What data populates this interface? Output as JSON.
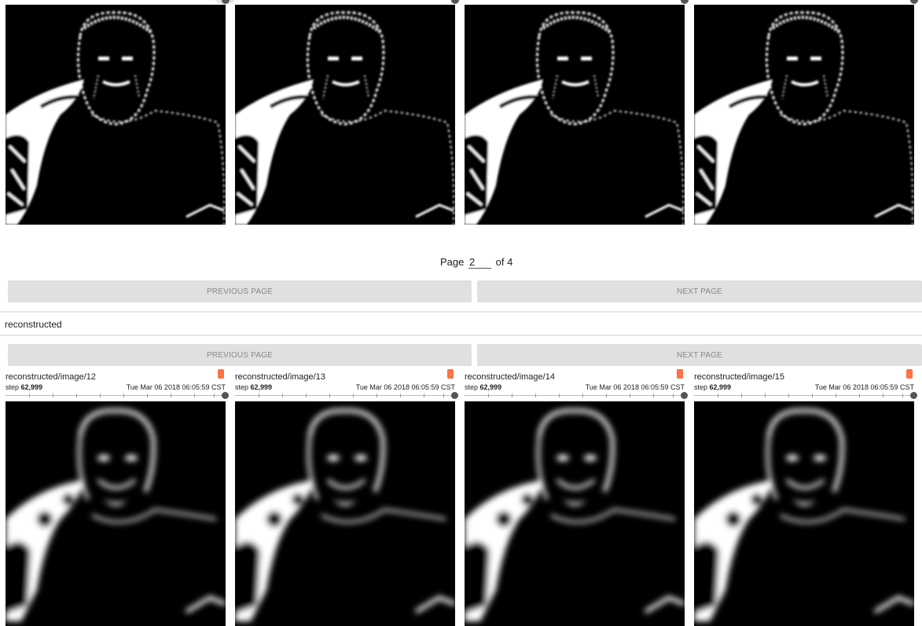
{
  "pagination": {
    "page_prefix": "Page",
    "page_value": "2",
    "page_suffix": "of 4",
    "previous_label": "PREVIOUS PAGE",
    "next_label": "NEXT PAGE"
  },
  "section": {
    "title": "reconstructed"
  },
  "cards": [
    {
      "title": "reconstructed/image/12",
      "step_label": "step",
      "step_value": "62,999",
      "time": "Tue Mar 06 2018 06:05:59 CST"
    },
    {
      "title": "reconstructed/image/13",
      "step_label": "step",
      "step_value": "62,999",
      "time": "Tue Mar 06 2018 06:05:59 CST"
    },
    {
      "title": "reconstructed/image/14",
      "step_label": "step",
      "step_value": "62,999",
      "time": "Tue Mar 06 2018 06:05:59 CST"
    },
    {
      "title": "reconstructed/image/15",
      "step_label": "step",
      "step_value": "62,999",
      "time": "Tue Mar 06 2018 06:05:59 CST"
    }
  ],
  "colors": {
    "accent_flag": "#ff7043",
    "button_bg": "#e0e0e0",
    "image_bg": "#000000"
  },
  "icons": {
    "flag": "warning-flag-icon",
    "slider": "step-slider"
  }
}
